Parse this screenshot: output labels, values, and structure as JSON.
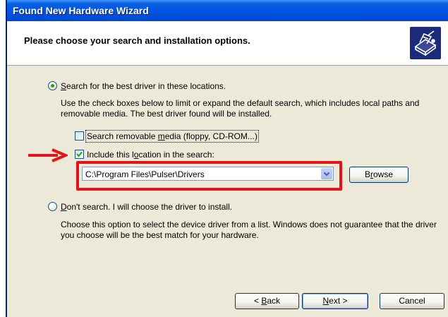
{
  "window": {
    "title": "Found New Hardware Wizard"
  },
  "header": {
    "title": "Please choose your search and installation options.",
    "icon": "hardware-wizard-icon"
  },
  "options": {
    "search_radio": {
      "pre": "",
      "accel": "S",
      "post": "earch for the best driver in these locations.",
      "selected": true
    },
    "search_description": "Use the check boxes below to limit or expand the default search, which includes local paths and removable media. The best driver found will be installed.",
    "removable_checkbox": {
      "pre": "Search removable ",
      "accel": "m",
      "post": "edia (floppy, CD-ROM...)",
      "checked": false
    },
    "include_checkbox": {
      "pre": "Include this l",
      "accel": "o",
      "post": "cation in the search:",
      "checked": true
    },
    "path_value": "C:\\Program Files\\Pulser\\Drivers",
    "browse_button": {
      "pre": "B",
      "accel": "r",
      "post": "owse"
    },
    "dont_search_radio": {
      "pre": "",
      "accel": "D",
      "post": "on't search. I will choose the driver to install.",
      "selected": false
    },
    "dont_search_description": "Choose this option to select the device driver from a list.  Windows does not guarantee that the driver you choose will be the best match for your hardware."
  },
  "footer": {
    "back_button": {
      "pre": "< ",
      "accel": "B",
      "post": "ack"
    },
    "next_button": {
      "pre": "",
      "accel": "N",
      "post": "ext >"
    },
    "cancel_label": "Cancel"
  },
  "annotation": {
    "color": "#e3151a"
  }
}
